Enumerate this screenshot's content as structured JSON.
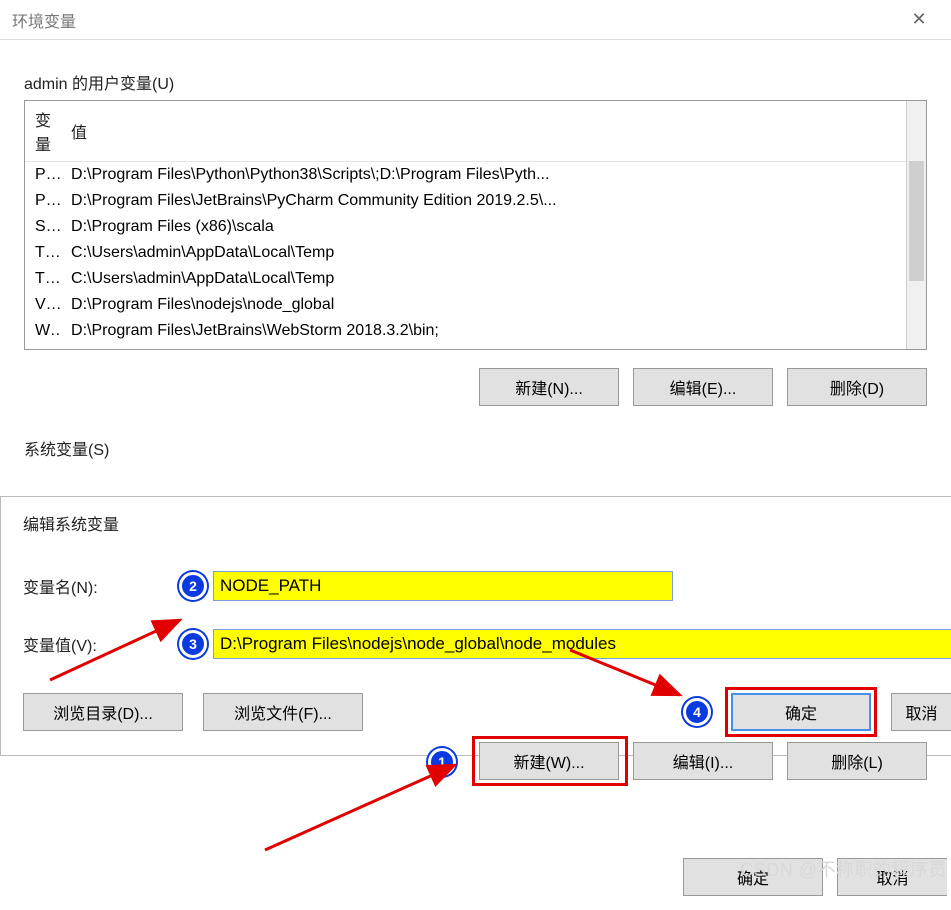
{
  "window": {
    "title": "环境变量"
  },
  "user_vars": {
    "title": "admin 的用户变量(U)",
    "columns": {
      "name": "变量",
      "value": "值"
    },
    "rows": [
      {
        "name": "Path",
        "value": "D:\\Program Files\\Python\\Python38\\Scripts\\;D:\\Program Files\\Pyth..."
      },
      {
        "name": "PyCharm Community Edition",
        "value": "D:\\Program Files\\JetBrains\\PyCharm Community Edition 2019.2.5\\..."
      },
      {
        "name": "SCALA_HOME",
        "value": "D:\\Program Files (x86)\\scala"
      },
      {
        "name": "TEMP",
        "value": "C:\\Users\\admin\\AppData\\Local\\Temp"
      },
      {
        "name": "TMP",
        "value": "C:\\Users\\admin\\AppData\\Local\\Temp"
      },
      {
        "name": "VUE",
        "value": "D:\\Program Files\\nodejs\\node_global"
      },
      {
        "name": "WebStorm",
        "value": "D:\\Program Files\\JetBrains\\WebStorm 2018.3.2\\bin;"
      }
    ],
    "buttons": {
      "new": "新建(N)...",
      "edit": "编辑(E)...",
      "delete": "删除(D)"
    }
  },
  "system_vars": {
    "title": "系统变量(S)",
    "buttons": {
      "new": "新建(W)...",
      "edit": "编辑(I)...",
      "delete": "删除(L)"
    }
  },
  "edit_dialog": {
    "title": "编辑系统变量",
    "name_label": "变量名(N):",
    "value_label": "变量值(V):",
    "name_value": "NODE_PATH",
    "value_value": "D:\\Program Files\\nodejs\\node_global\\node_modules",
    "browse_dir": "浏览目录(D)...",
    "browse_file": "浏览文件(F)...",
    "ok": "确定",
    "cancel": "取消"
  },
  "main_buttons": {
    "ok": "确定",
    "cancel": "取消"
  },
  "annotations": {
    "b1": "1",
    "b2": "2",
    "b3": "3",
    "b4": "4"
  },
  "watermark": "CSDN @不称职的程序员",
  "colors": {
    "highlight_yellow": "#ffff00",
    "annotation_red": "#e00000",
    "badge_blue": "#0a3ae0"
  }
}
